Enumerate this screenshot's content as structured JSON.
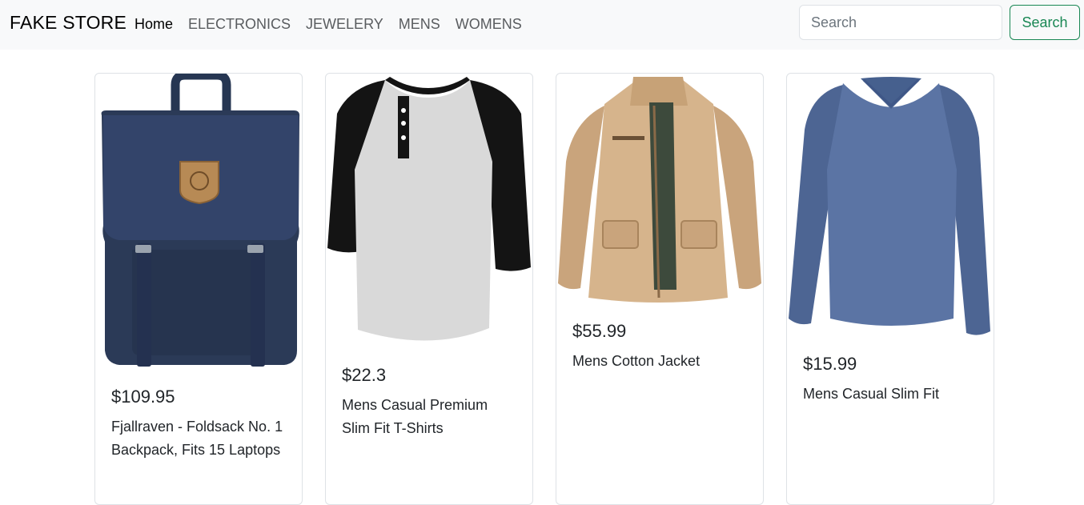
{
  "navbar": {
    "brand": "FAKE STORE",
    "links": [
      {
        "label": "Home",
        "active": true
      },
      {
        "label": "ELECTRONICS"
      },
      {
        "label": "JEWELERY"
      },
      {
        "label": "MENS"
      },
      {
        "label": "WOMENS"
      }
    ],
    "search": {
      "placeholder": "Search",
      "button_label": "Search"
    }
  },
  "accent_color": "#198754",
  "products": [
    {
      "price": "$109.95",
      "title": "Fjallraven - Foldsack No. 1 Backpack, Fits 15 Laptops",
      "image": "navy-backpack"
    },
    {
      "price": "$22.3",
      "title": "Mens Casual Premium Slim Fit T-Shirts",
      "image": "raglan-henley-tshirt"
    },
    {
      "price": "$55.99",
      "title": "Mens Cotton Jacket",
      "image": "khaki-jacket"
    },
    {
      "price": "$15.99",
      "title": "Mens Casual Slim Fit",
      "image": "blue-longsleeve-tee"
    }
  ]
}
